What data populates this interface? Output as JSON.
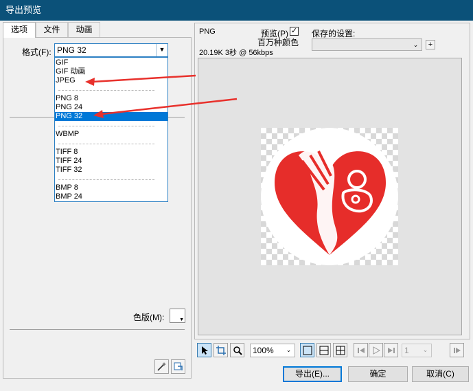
{
  "window": {
    "title": "导出预览"
  },
  "tabs": [
    {
      "label": "选项",
      "active": true
    },
    {
      "label": "文件",
      "active": false
    },
    {
      "label": "动画",
      "active": false
    }
  ],
  "options": {
    "format_label": "格式(F):",
    "format_value": "PNG 32",
    "palette_label": "色版(M):"
  },
  "dropdown": {
    "items": [
      {
        "label": "GIF",
        "selected": false
      },
      {
        "label": "GIF 动画",
        "selected": false
      },
      {
        "label": "JPEG",
        "selected": false
      },
      {
        "label": "PNG 8",
        "selected": false
      },
      {
        "label": "PNG 24",
        "selected": false
      },
      {
        "label": "PNG 32",
        "selected": true
      },
      {
        "label": "WBMP",
        "selected": false
      },
      {
        "label": "TIFF 8",
        "selected": false
      },
      {
        "label": "TIFF 24",
        "selected": false
      },
      {
        "label": "TIFF 32",
        "selected": false
      },
      {
        "label": "BMP 8",
        "selected": false
      },
      {
        "label": "BMP 24",
        "selected": false
      }
    ]
  },
  "preview": {
    "format": "PNG",
    "preview_checkbox_label": "预览(P)",
    "preview_checked": true,
    "color_mode": "百万种颜色",
    "info": "20.19K  3秒 @ 56kbps",
    "saved_settings_label": "保存的设置:",
    "saved_settings_value": "",
    "add_icon": "plus-icon"
  },
  "logo": {
    "circle_color": "#ffffff",
    "heart_color": "#e62d2a"
  },
  "toolbar": {
    "zoom_value": "100%",
    "frame_value": "1",
    "icons": [
      "pointer-icon",
      "crop-icon",
      "zoom-icon",
      "single-view-icon",
      "split-2-view-icon",
      "split-4-view-icon",
      "first-frame-icon",
      "play-icon",
      "last-frame-icon",
      "next-frame-icon"
    ]
  },
  "buttons": {
    "export": "导出(E)...",
    "ok": "确定",
    "cancel": "取消(C)"
  },
  "annotation": {
    "arrow_color": "#e8312c"
  }
}
